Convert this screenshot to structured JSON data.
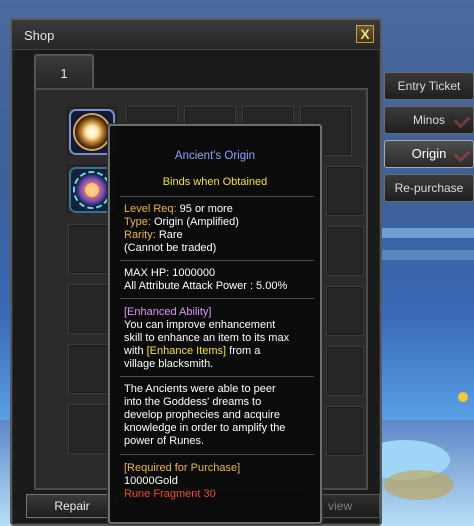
{
  "window": {
    "title": "Shop",
    "close_glyph": "X"
  },
  "page_tab": {
    "label": "1"
  },
  "side_tabs": [
    {
      "label": "Entry Ticket",
      "active": false
    },
    {
      "label": "Minos",
      "active": false
    },
    {
      "label": "Origin",
      "active": true
    },
    {
      "label": "Re-purchase",
      "active": false
    }
  ],
  "buttons": {
    "repair": "Repair",
    "review": "view"
  },
  "items": [
    {
      "icon": "glowing-orb-icon"
    },
    {
      "icon": "rune-compass-icon"
    }
  ],
  "tooltip": {
    "name": "Ancient's Origin",
    "binds": "Binds when Obtained",
    "level_key": "Level Req:",
    "level_val": " 95 or more",
    "type_key": "Type:",
    "type_val": " Origin (Amplified)",
    "rarity_key": "Rarity:",
    "rarity_val": " Rare",
    "trade": "(Cannot be traded)",
    "max_hp": "MAX HP: 1000000",
    "attack": "All Attribute Attack Power : 5.00%",
    "enhanced_header": "[Enhanced Ability]",
    "enh_l1": "You can improve enhancement",
    "enh_l2": "skill to enhance an item to its max",
    "enh_l3_pre": "with ",
    "enh_l3_link": "[Enhance Items]",
    "enh_l3_post": " from a",
    "enh_l4": "village blacksmith.",
    "lore_l1": "The Ancients were able to peer",
    "lore_l2": "into the Goddess' dreams to",
    "lore_l3": "develop prophecies and acquire",
    "lore_l4": "knowledge in order to amplify the",
    "lore_l5": "power of Runes.",
    "purchase_header": "[Required for Purchase]",
    "price_gold": "10000Gold",
    "price_rune": "Rune Fragment 30"
  },
  "colors": {
    "item_name": "#8fa3ff",
    "binds": "#f1e04b",
    "key": "#e7b84c",
    "enhanced": "#d89bf0",
    "link": "#f4e33f",
    "header": "#efb347",
    "rune_price": "#ea4b3d"
  }
}
